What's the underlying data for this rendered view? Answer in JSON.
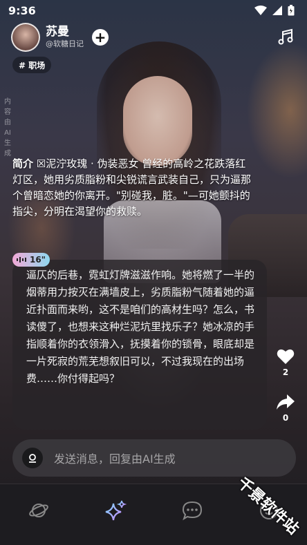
{
  "status_bar": {
    "time": "9:36"
  },
  "header": {
    "name": "苏曼",
    "handle": "@软糖日记",
    "follow_symbol": "+"
  },
  "tag": "# 职场",
  "ai_notice": "内容由AI生成",
  "intro": {
    "label": "简介",
    "text": " ☒泥泞玫瑰 · 伪装恶女 曾经的高岭之花跌落红灯区，她用劣质脂粉和尖锐谎言武装自己，只为逼那个曾暗恋她的你离开。\"别碰我，脏。\"—可她颤抖的指尖，分明在渴望你的救赎。"
  },
  "voice_badge": {
    "duration": "16\""
  },
  "chat": {
    "message": "逼仄的后巷，霓虹灯牌滋滋作响。她将燃了一半的烟蒂用力按灭在满墙皮上，劣质脂粉气随着她的逼近扑面而来哟，这不是咱们的高材生吗？怎么，书读傻了，也想来这种烂泥坑里找乐子？她冰凉的手指顺着你的衣领滑入，抚摸着你的锁骨，眼底却是一片死寂的荒芜想叙旧可以，不过我现在的出场费……你付得起吗？"
  },
  "side_actions": {
    "likes": "2",
    "shares": "0"
  },
  "input": {
    "placeholder": "发送消息，回复由AI生成"
  },
  "watermark": "千景软件站",
  "colors": {
    "badge_gradient_start": "#f2a8d6",
    "badge_gradient_end": "#8fd8f0",
    "nav_active": "#b59cff"
  },
  "icons": {
    "status": [
      "wifi-icon",
      "signal-icon",
      "battery-icon"
    ],
    "header": [
      "music-icon"
    ],
    "side": [
      "heart-icon",
      "share-icon"
    ],
    "input": [
      "voice-icon"
    ],
    "nav": [
      "cosmos-icon",
      "sparkle-icon",
      "chat-bubble-icon",
      "profile-icon"
    ]
  }
}
